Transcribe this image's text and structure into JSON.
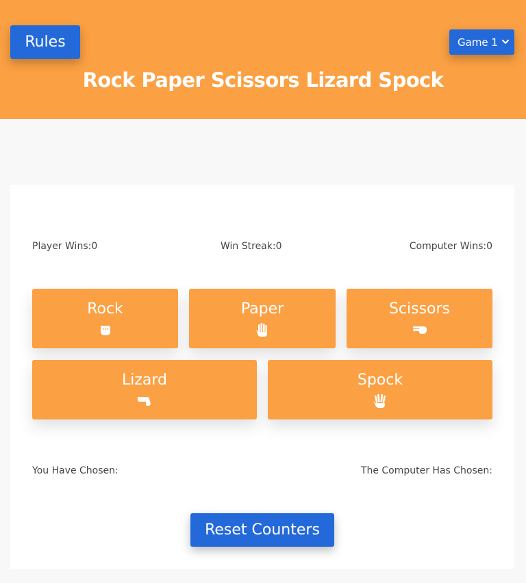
{
  "header": {
    "rules_label": "Rules",
    "game_select": {
      "selected": "Game 1"
    },
    "title": "Rock Paper Scissors Lizard Spock"
  },
  "stats": {
    "player_wins": "Player Wins:0",
    "win_streak": "Win Streak:0",
    "computer_wins": "Computer Wins:0"
  },
  "choices": [
    {
      "label": "Rock",
      "icon": "rock-hand-icon"
    },
    {
      "label": "Paper",
      "icon": "paper-hand-icon"
    },
    {
      "label": "Scissors",
      "icon": "scissors-hand-icon"
    },
    {
      "label": "Lizard",
      "icon": "lizard-hand-icon"
    },
    {
      "label": "Spock",
      "icon": "spock-hand-icon"
    }
  ],
  "result": {
    "you_chosen": "You Have Chosen:",
    "computer_chosen": "The Computer Has Chosen:"
  },
  "reset_label": "Reset Counters",
  "colors": {
    "header_bg": "#fba043",
    "button_blue": "#2469d9",
    "choice_bg": "#fba043"
  }
}
